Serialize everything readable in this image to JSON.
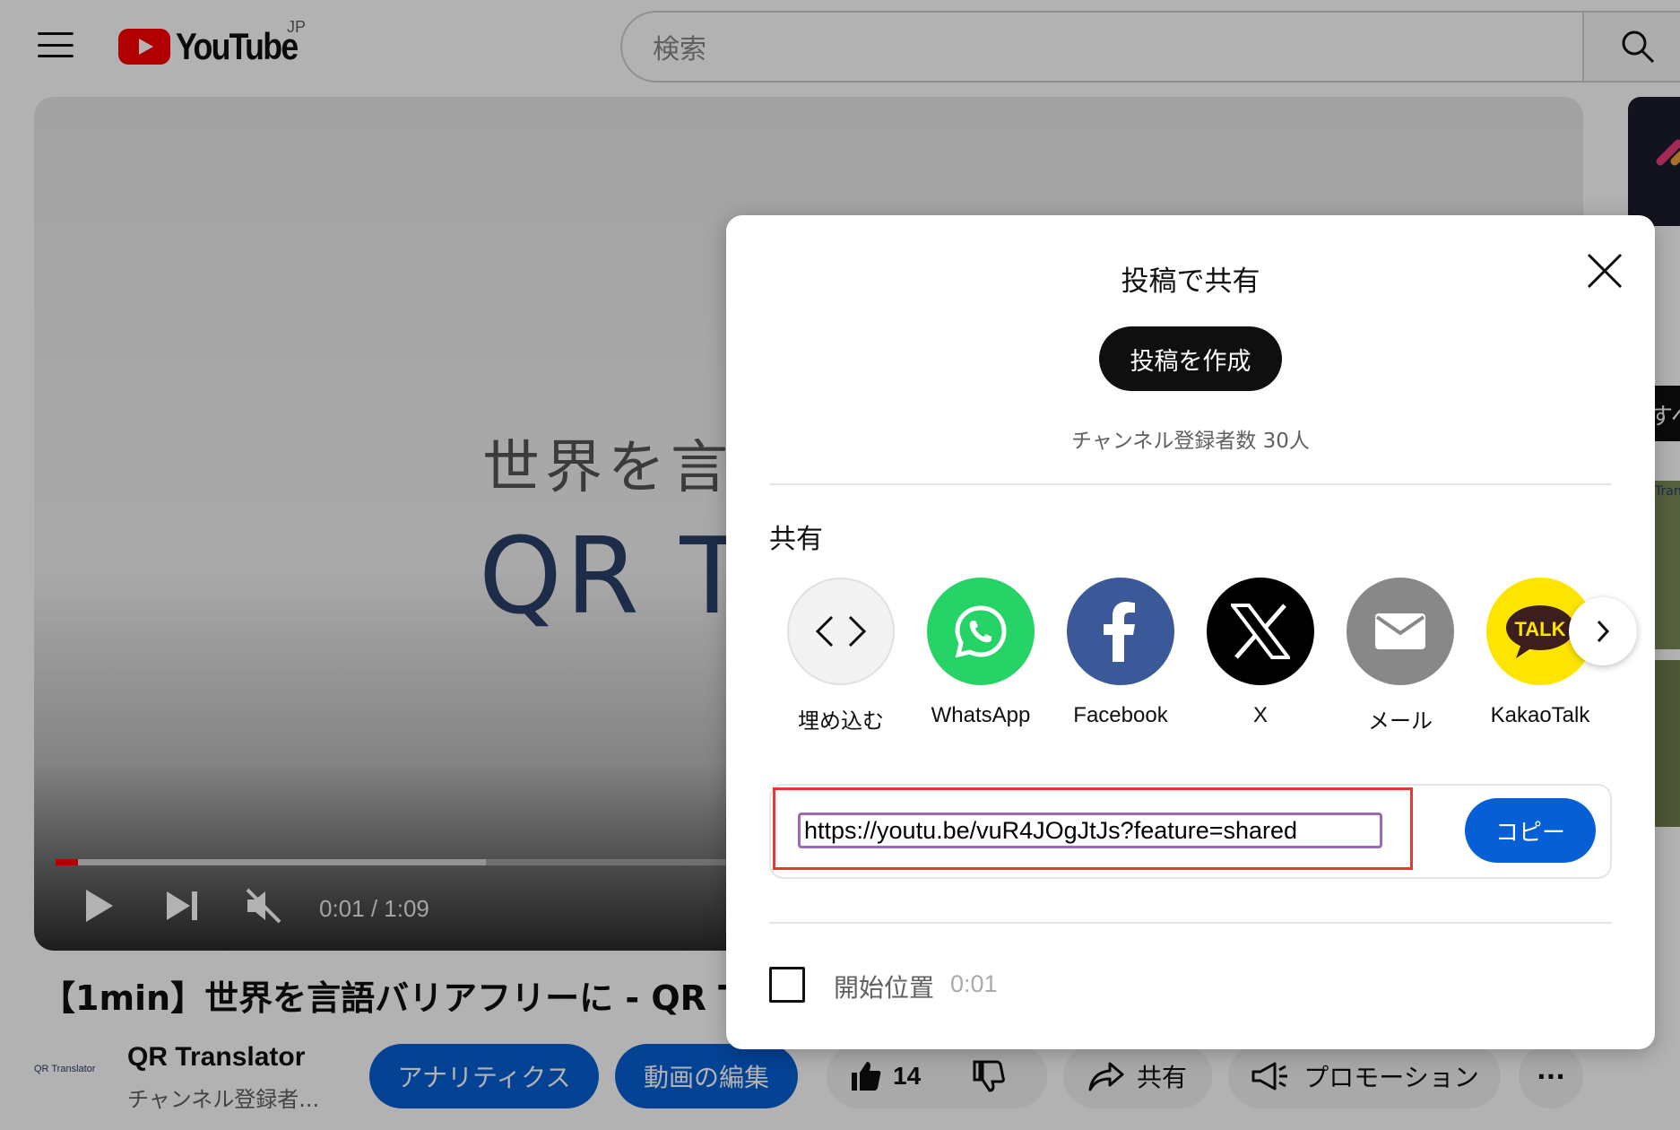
{
  "header": {
    "logo_text": "YouTube",
    "region": "JP",
    "search_placeholder": "検索"
  },
  "player": {
    "overlay_line1": "世界を言語",
    "overlay_line2": "QR Tr",
    "time": "0:01 / 1:09",
    "progress_fraction": 0.015
  },
  "video": {
    "title": "【1min】世界を言語バリアフリーに - QR T",
    "channel_logo_text": "QR Translator",
    "channel_name": "QR Translator",
    "channel_subs": "チャンネル登録者...",
    "analytics_label": "アナリティクス",
    "edit_label": "動画の編集",
    "like_count": "14",
    "share_label": "共有",
    "promotion_label": "プロモーション",
    "more_label": "···"
  },
  "sidebar": {
    "chip_text": "すべ",
    "thumb_text": "Tran"
  },
  "dialog": {
    "title": "投稿で共有",
    "create_post_label": "投稿を作成",
    "subscriber_count": "チャンネル登録者数 30人",
    "share_heading": "共有",
    "targets": [
      {
        "label": "埋め込む",
        "icon": "embed-icon",
        "color": "#f2f2f2"
      },
      {
        "label": "WhatsApp",
        "icon": "whatsapp-icon",
        "color": "#25d366"
      },
      {
        "label": "Facebook",
        "icon": "facebook-icon",
        "color": "#1877f2"
      },
      {
        "label": "X",
        "icon": "x-icon",
        "color": "#000000"
      },
      {
        "label": "メール",
        "icon": "mail-icon",
        "color": "#888888"
      },
      {
        "label": "KakaoTalk",
        "icon": "kakaotalk-icon",
        "color": "#fee500"
      }
    ],
    "kakao_badge": "TALK",
    "url": "https://youtu.be/vuR4JOgJtJs?feature=shared",
    "copy_label": "コピー",
    "start_position_label": "開始位置",
    "start_position_time": "0:01"
  },
  "colors": {
    "brand_red": "#ff0000",
    "primary_blue": "#065fd4",
    "highlight_red": "#e53a2f",
    "focus_purple": "#9d68b8"
  }
}
